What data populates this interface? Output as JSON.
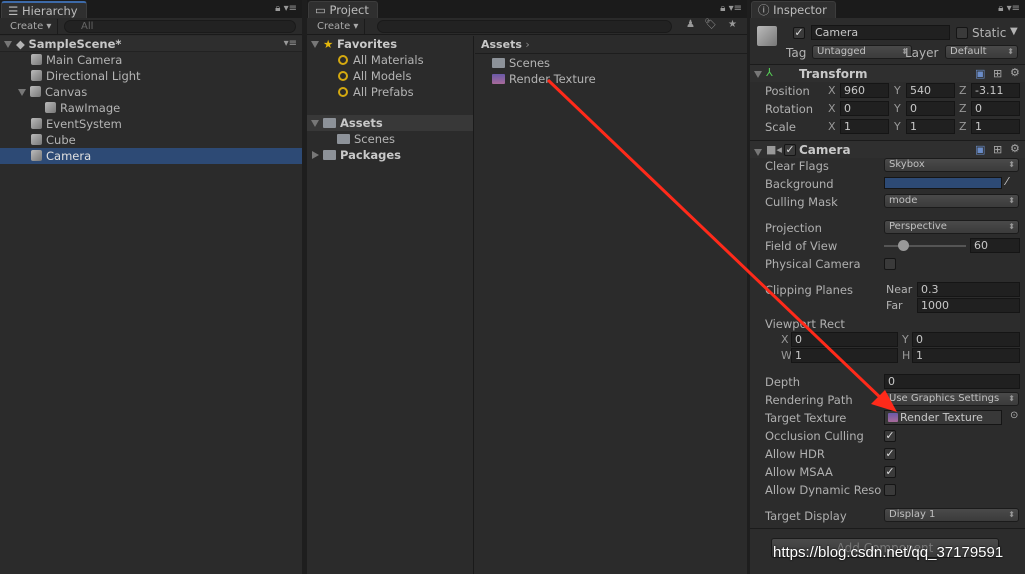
{
  "hierarchy": {
    "tab": "Hierarchy",
    "create": "Create ▾",
    "search_placeholder": "All",
    "scene": "SampleScene*",
    "items": [
      {
        "label": "Main Camera"
      },
      {
        "label": "Directional Light"
      },
      {
        "label": "Canvas"
      },
      {
        "label": "RawImage"
      },
      {
        "label": "EventSystem"
      },
      {
        "label": "Cube"
      },
      {
        "label": "Camera",
        "selected": true
      }
    ]
  },
  "project": {
    "tab": "Project",
    "create": "Create ▾",
    "search_placeholder": "",
    "favorites": "Favorites",
    "favorite_items": [
      "All Materials",
      "All Models",
      "All Prefabs"
    ],
    "assets": "Assets",
    "asset_children": [
      "Scenes"
    ],
    "packages": "Packages",
    "breadcrumb": "Assets",
    "files": [
      "Scenes",
      "Render Texture"
    ]
  },
  "inspector": {
    "tab": "Inspector",
    "name": "Camera",
    "static": "Static",
    "tag_label": "Tag",
    "tag": "Untagged",
    "layer_label": "Layer",
    "layer": "Default",
    "transform": {
      "title": "Transform",
      "position_label": "Position",
      "rotation_label": "Rotation",
      "scale_label": "Scale",
      "position": {
        "x": "960",
        "y": "540",
        "z": "-3.11"
      },
      "rotation": {
        "x": "0",
        "y": "0",
        "z": "0"
      },
      "scale": {
        "x": "1",
        "y": "1",
        "z": "1"
      }
    },
    "camera": {
      "title": "Camera",
      "clear_flags_label": "Clear Flags",
      "clear_flags": "Skybox",
      "background_label": "Background",
      "background_color": "#2d4a75",
      "culling_mask_label": "Culling Mask",
      "culling_mask": "mode",
      "projection_label": "Projection",
      "projection": "Perspective",
      "fov_label": "Field of View",
      "fov": "60",
      "fov_fraction": 0.17,
      "physical_label": "Physical Camera",
      "clipping_label": "Clipping Planes",
      "near_label": "Near",
      "near": "0.3",
      "far_label": "Far",
      "far": "1000",
      "viewport_label": "Viewport Rect",
      "vx": "0",
      "vy": "0",
      "vw": "1",
      "vh": "1",
      "depth_label": "Depth",
      "depth": "0",
      "rendering_path_label": "Rendering Path",
      "rendering_path": "Use Graphics Settings",
      "target_texture_label": "Target Texture",
      "target_texture": "Render Texture",
      "occlusion_label": "Occlusion Culling",
      "hdr_label": "Allow HDR",
      "msaa_label": "Allow MSAA",
      "dynamic_label": "Allow Dynamic Reso",
      "target_display_label": "Target Display",
      "target_display": "Display 1"
    },
    "add_component": "Add Component"
  },
  "axis": {
    "x": "X",
    "y": "Y",
    "z": "Z",
    "w": "W",
    "h": "H"
  },
  "watermark": "https://blog.csdn.net/qq_37179591",
  "arrow_color": "#ff2a1a"
}
